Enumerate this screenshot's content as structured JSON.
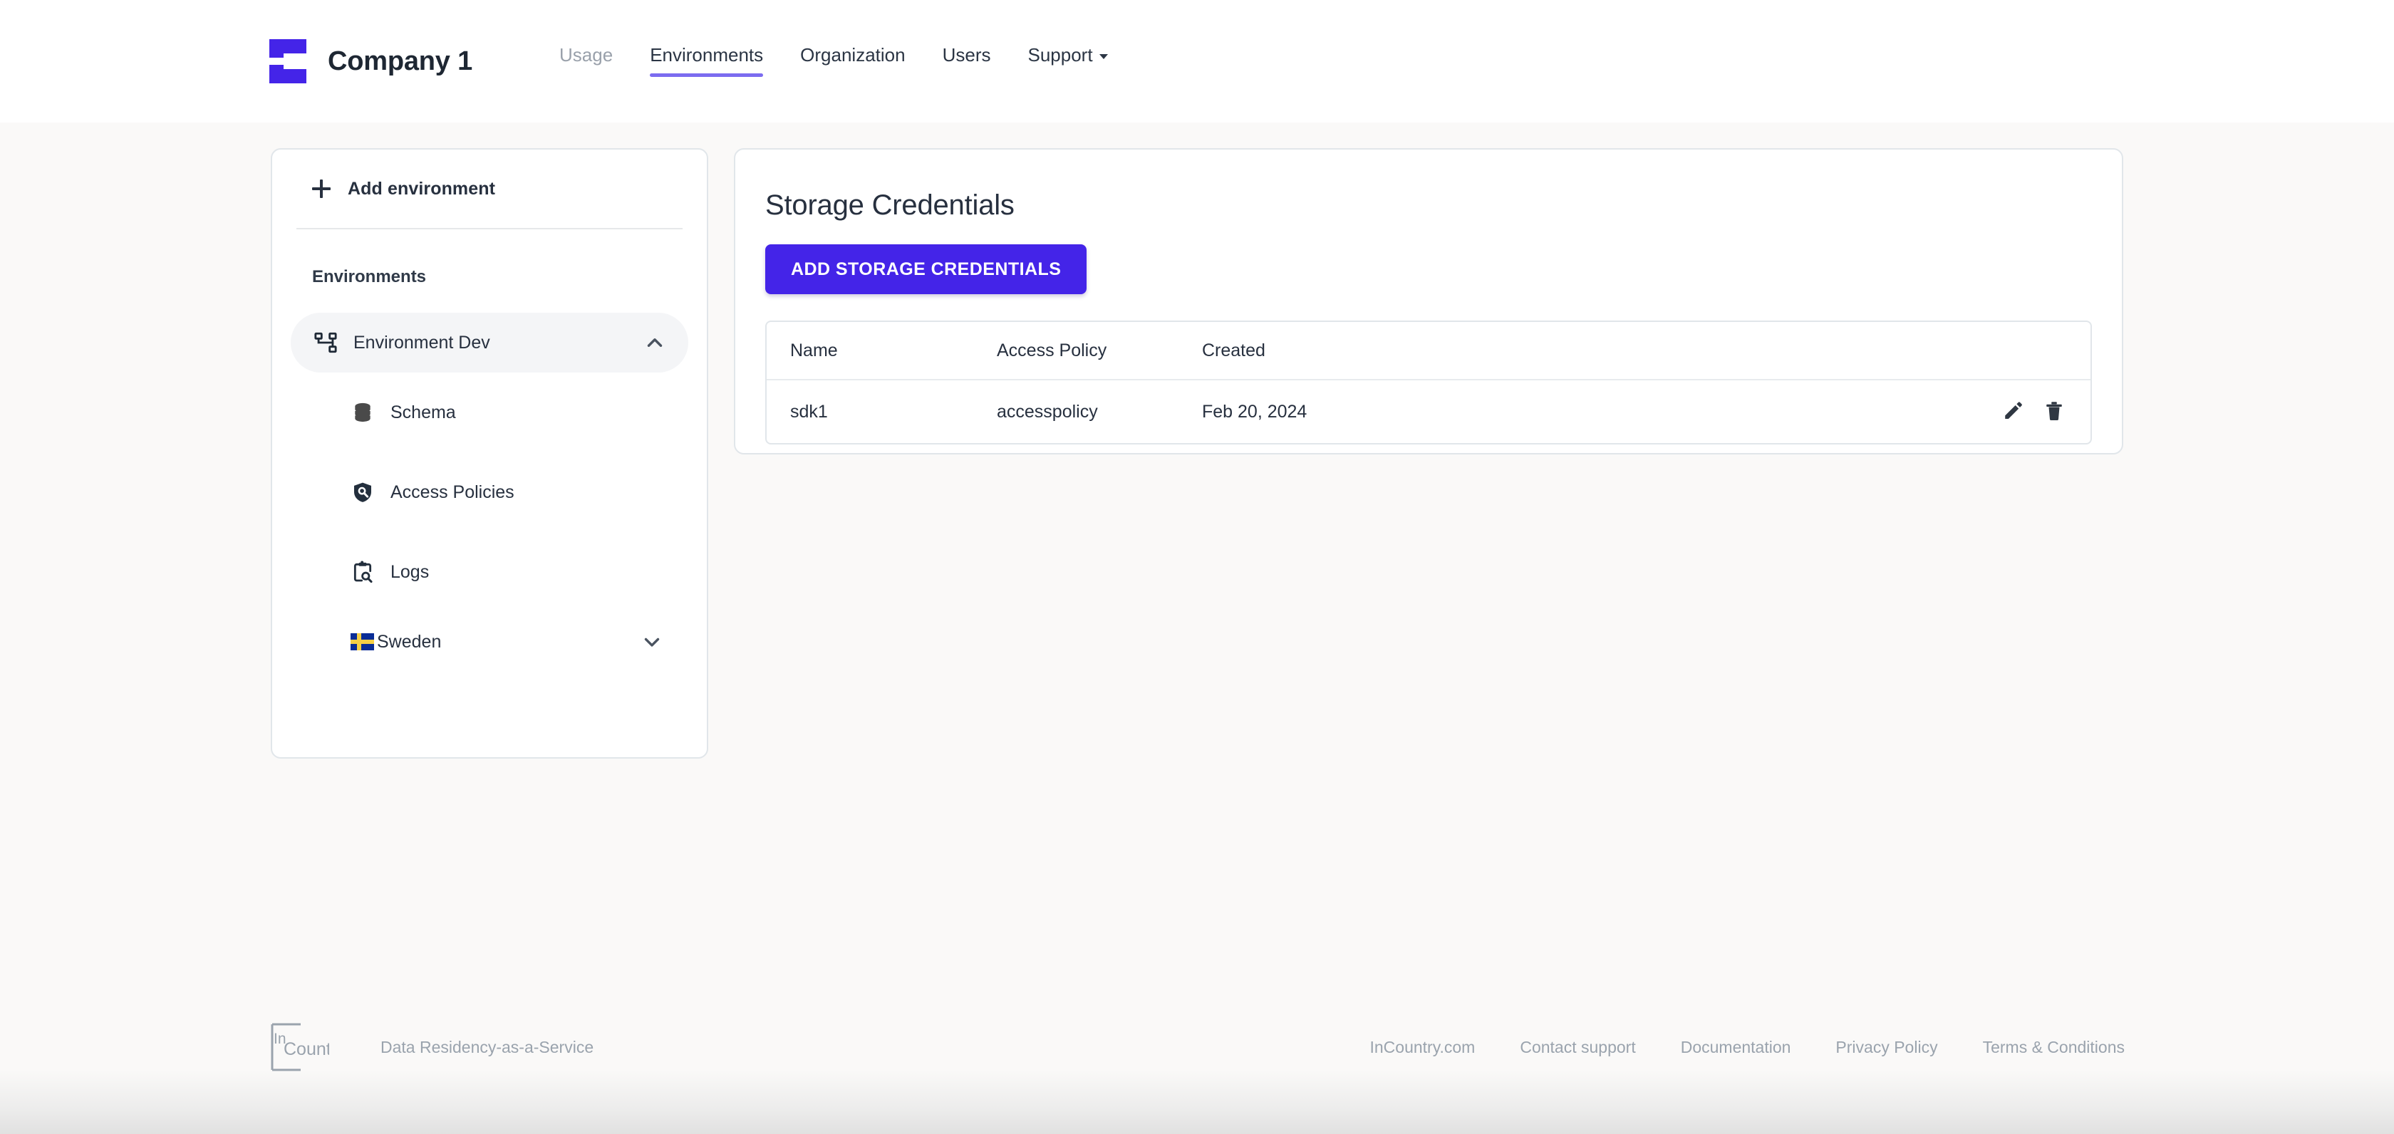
{
  "header": {
    "logo_icon": "incountry-bracket-logo",
    "company": "Company 1",
    "nav": [
      {
        "label": "Usage",
        "state": "muted",
        "has_caret": false
      },
      {
        "label": "Environments",
        "state": "active",
        "has_caret": false
      },
      {
        "label": "Organization",
        "state": "normal",
        "has_caret": false
      },
      {
        "label": "Users",
        "state": "normal",
        "has_caret": false
      },
      {
        "label": "Support",
        "state": "normal",
        "has_caret": true
      }
    ],
    "accent_underline_color": "#7c6cf0"
  },
  "sidebar": {
    "add_environment_label": "Add environment",
    "add_icon": "plus-icon",
    "section_heading": "Environments",
    "environment": {
      "label": "Environment Dev",
      "icon": "account-tree-icon",
      "expanded": true,
      "chevron": "chevron-up-icon",
      "selected_bg": "#f4f5f7"
    },
    "children": [
      {
        "label": "Schema",
        "icon": "database-icon"
      },
      {
        "label": "Access Policies",
        "icon": "shield-search-icon"
      },
      {
        "label": "Logs",
        "icon": "clipboard-search-icon"
      }
    ],
    "country": {
      "label": "Sweden",
      "icon": "sweden-flag-icon",
      "flag_blue": "#0a2d96",
      "flag_yellow": "#f6d045",
      "expanded": false,
      "chevron": "chevron-down-icon"
    }
  },
  "main": {
    "title": "Storage Credentials",
    "primary_button": {
      "label": "ADD STORAGE CREDENTIALS",
      "color": "#4424e8",
      "text_color": "#ffffff"
    },
    "table": {
      "columns": [
        "Name",
        "Access Policy",
        "Created",
        ""
      ],
      "rows": [
        {
          "name": "sdk1",
          "access_policy": "accesspolicy",
          "created": "Feb 20, 2024",
          "actions": [
            {
              "icon": "edit-pencil-icon",
              "name": "edit-credential-button"
            },
            {
              "icon": "trash-bin-icon",
              "name": "delete-credential-button"
            }
          ]
        }
      ]
    }
  },
  "footer": {
    "logo_icon": "incountry-wordmark-logo",
    "logo_text_top": "In",
    "logo_text_bottom": "Country",
    "tagline": "Data Residency-as-a-Service",
    "links": [
      "InCountry.com",
      "Contact support",
      "Documentation",
      "Privacy Policy",
      "Terms & Conditions"
    ]
  }
}
